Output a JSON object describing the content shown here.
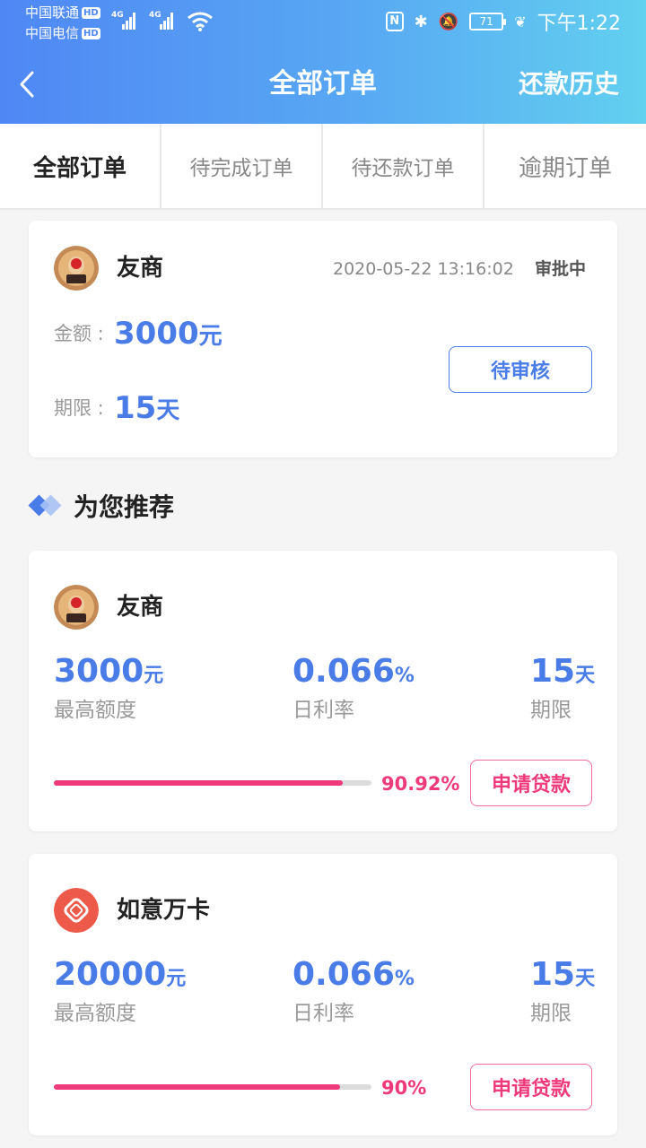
{
  "status_bar": {
    "carrier1": "中国联通",
    "carrier2": "中国电信",
    "hd": "HD",
    "net1": "4G",
    "net2": "4G",
    "nfc": "N",
    "battery": "71",
    "time": "下午1:22"
  },
  "header": {
    "title": "全部订单",
    "history_label": "还款历史"
  },
  "tabs": [
    {
      "label": "全部订单",
      "active": true
    },
    {
      "label": "待完成订单",
      "active": false
    },
    {
      "label": "待还款订单",
      "active": false
    },
    {
      "label": "逾期订单",
      "active": false
    }
  ],
  "order": {
    "name": "友商",
    "date": "2020-05-22 13:16:02",
    "state": "审批中",
    "amount_label": "金额 :",
    "amount_value": "3000",
    "amount_unit": "元",
    "term_label": "期限 :",
    "term_value": "15",
    "term_unit": "天",
    "button": "待审核"
  },
  "recommend": {
    "title": "为您推荐",
    "items": [
      {
        "name": "友商",
        "amount": "3000",
        "amount_unit": "元",
        "amount_label": "最高额度",
        "rate": "0.066",
        "rate_unit": "%",
        "rate_label": "日利率",
        "term": "15",
        "term_unit": "天",
        "term_label": "期限",
        "progress": 0.9092,
        "progress_text": "90.92%",
        "button": "申请贷款"
      },
      {
        "name": "如意万卡",
        "amount": "20000",
        "amount_unit": "元",
        "amount_label": "最高额度",
        "rate": "0.066",
        "rate_unit": "%",
        "rate_label": "日利率",
        "term": "15",
        "term_unit": "天",
        "term_label": "期限",
        "progress": 0.9,
        "progress_text": "90%",
        "button": "申请贷款"
      }
    ]
  },
  "colors": {
    "accent_blue": "#4a7ce8",
    "accent_pink": "#ee3a7b"
  }
}
